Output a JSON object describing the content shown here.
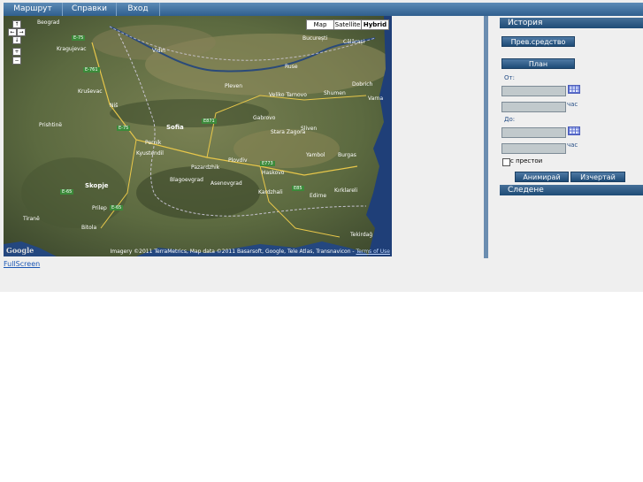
{
  "nav": {
    "items": [
      {
        "label": "Маршрут"
      },
      {
        "label": "Справки"
      },
      {
        "label": "Вход"
      }
    ]
  },
  "map": {
    "types": [
      "Map",
      "Satellite",
      "Hybrid"
    ],
    "active_type": "Hybrid",
    "attribution": "Imagery ©2011 TerraMetrics, Map data ©2011 Basarsoft, Google, Tele Atlas, Transnavicon -",
    "terms_link": "Terms of Use",
    "logo": "Google",
    "labels": {
      "beograd": "Beograd",
      "bucuresti": "București",
      "kragujevac": "Kragujevac",
      "krusevac": "Kruševac",
      "nis": "Niš",
      "pristina": "Prishtinë",
      "sofia": "Sofia",
      "pleven": "Pleven",
      "veliko_tarnovo": "Veliko Tarnovo",
      "ruse": "Ruse",
      "shumen": "Shumen",
      "varna": "Varna",
      "dobrich": "Dobrich",
      "plovdiv": "Plovdiv",
      "stara_zagora": "Stara Zagora",
      "sliven": "Sliven",
      "burgas": "Burgas",
      "yambol": "Yambol",
      "haskovo": "Haskovo",
      "skopje": "Skopje",
      "pazardzhik": "Pazardzhik",
      "blagoevgrad": "Blagoevgrad",
      "kardzhali": "Kardzhali",
      "edirne": "Edirne",
      "tirane": "Tiranë",
      "kyustendil": "Kyustendil",
      "asenovgrad": "Asenovgrad",
      "gabrovo": "Gabrovo",
      "pernik": "Pernik",
      "vidin": "Vidin",
      "calarasi": "Călărași",
      "kirklareli": "Kırklareli",
      "prilep": "Prilep",
      "bitola": "Bitola",
      "tekirdag": "Tekirdağ"
    },
    "road_badges": [
      "E-75",
      "E-761",
      "E-75",
      "E871",
      "E773",
      "E85",
      "E-65",
      "E-65"
    ]
  },
  "fullscreen_link": "FullScreen",
  "panel": {
    "history_header": "История",
    "vehicle_button": "Прев.средство",
    "plan_button": "План",
    "from_label": "От:",
    "to_label": "До:",
    "hour_unit": "час",
    "stops_label": "с престои",
    "animate_button": "Анимирай",
    "draw_button": "Изчертай",
    "tracking_header": "Следене",
    "from_date": "",
    "from_time": "",
    "to_date": "",
    "to_time": "",
    "stops_checked": false
  }
}
